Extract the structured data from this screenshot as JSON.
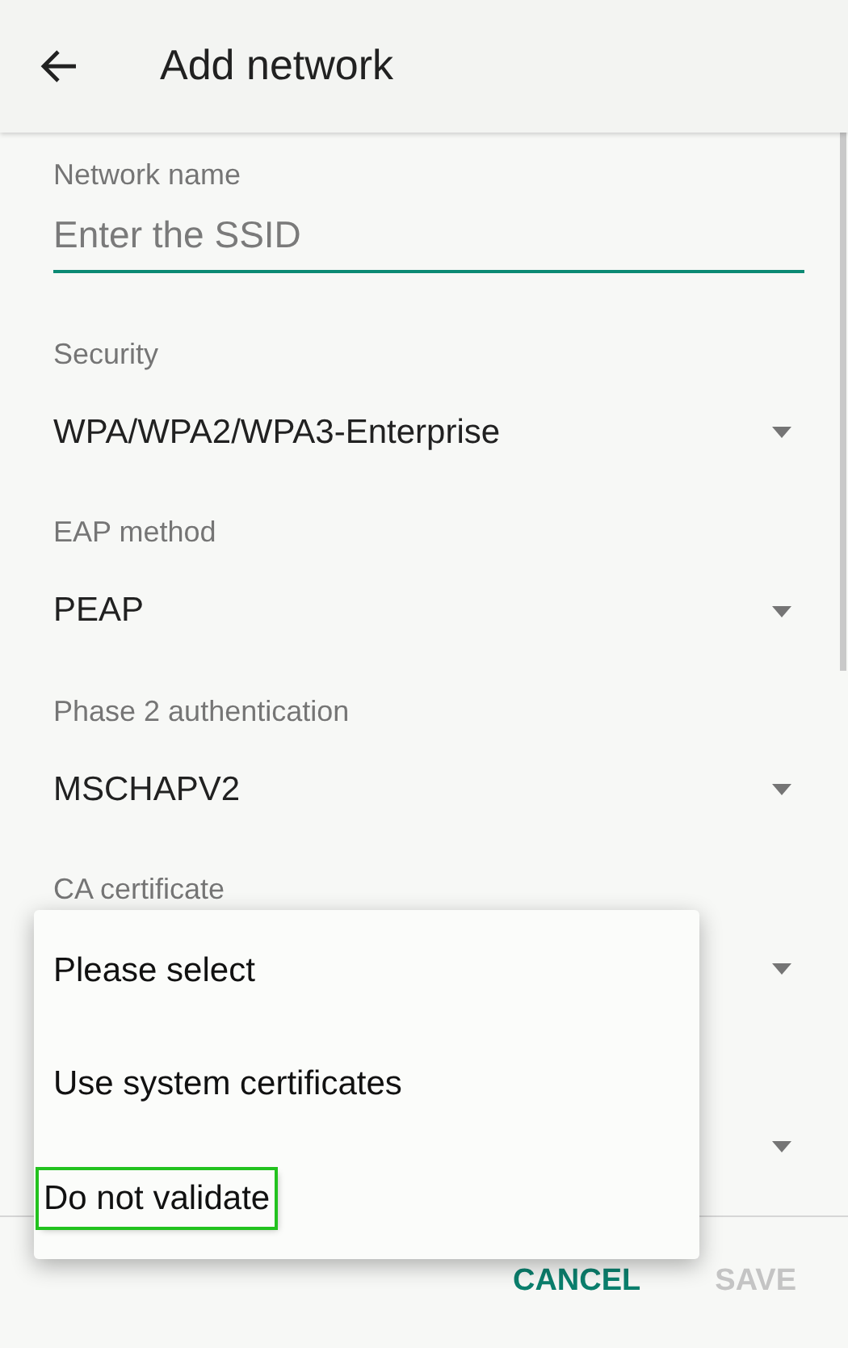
{
  "toolbar": {
    "title": "Add network"
  },
  "fields": [
    {
      "kind": "text",
      "label": "Network name",
      "placeholder": "Enter the SSID"
    },
    {
      "kind": "dropdown",
      "label": "Security",
      "value": "WPA/WPA2/WPA3-Enterprise"
    },
    {
      "kind": "dropdown",
      "label": "EAP method",
      "value": "PEAP"
    },
    {
      "kind": "dropdown",
      "label": "Phase 2 authentication",
      "value": "MSCHAPV2"
    },
    {
      "kind": "dropdown",
      "label": "CA certificate"
    },
    {
      "kind": "dropdown"
    }
  ],
  "menu": {
    "items": [
      {
        "label": "Please select",
        "highlighted": false
      },
      {
        "label": "Use system certificates",
        "highlighted": false
      },
      {
        "label": "Do not validate",
        "highlighted": true
      }
    ]
  },
  "buttons": [
    {
      "label": "CANCEL",
      "disabled": false
    },
    {
      "label": "SAVE",
      "disabled": true
    }
  ]
}
